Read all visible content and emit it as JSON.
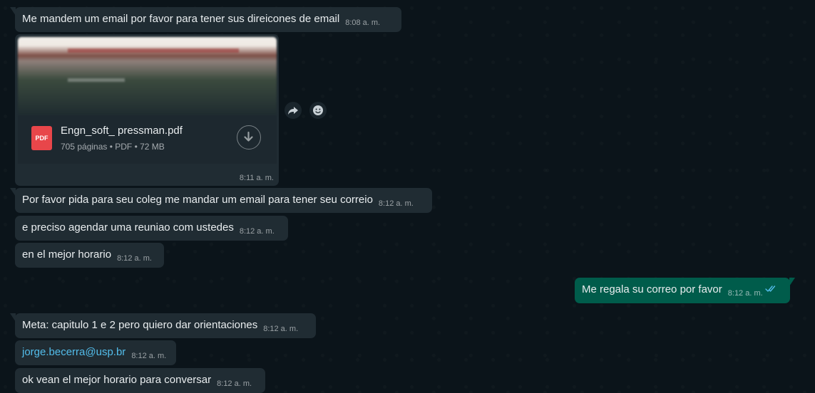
{
  "messages": [
    {
      "text": "Me mandem um email por favor  para tener sus direicones de email",
      "time": "8:08 a. m."
    },
    {
      "text": "Por favor pida para seu coleg me mandar um email para tener seu correio",
      "time": "8:12 a. m."
    },
    {
      "text": "e preciso agendar uma reuniao com ustedes",
      "time": "8:12 a. m."
    },
    {
      "text": "en el mejor horario",
      "time": "8:12 a. m."
    },
    {
      "text": "Me regala su correo por favor",
      "time": "8:12 a. m."
    },
    {
      "text": "Meta: capitulo 1 e 2 pero quiero dar orientaciones",
      "time": "8:12 a. m."
    },
    {
      "text": "jorge.becerra@usp.br",
      "time": "8:12 a. m."
    },
    {
      "text": "ok vean el mejor horario para conversar",
      "time": "8:12 a. m."
    }
  ],
  "document": {
    "icon_label": "PDF",
    "filename": "Engn_soft_ pressman.pdf",
    "meta": "705 páginas • PDF • 72 MB",
    "time": "8:11 a. m."
  },
  "icons": {
    "forward": "forward-icon",
    "emoji": "emoji-icon",
    "download": "download-icon",
    "read_receipt": "double-check-icon"
  },
  "colors": {
    "background": "#0b141a",
    "incoming_bubble": "#202c33",
    "outgoing_bubble": "#005c4b",
    "link": "#53bdeb",
    "read_ticks": "#53bdeb",
    "pdf_icon": "#e8464a"
  }
}
